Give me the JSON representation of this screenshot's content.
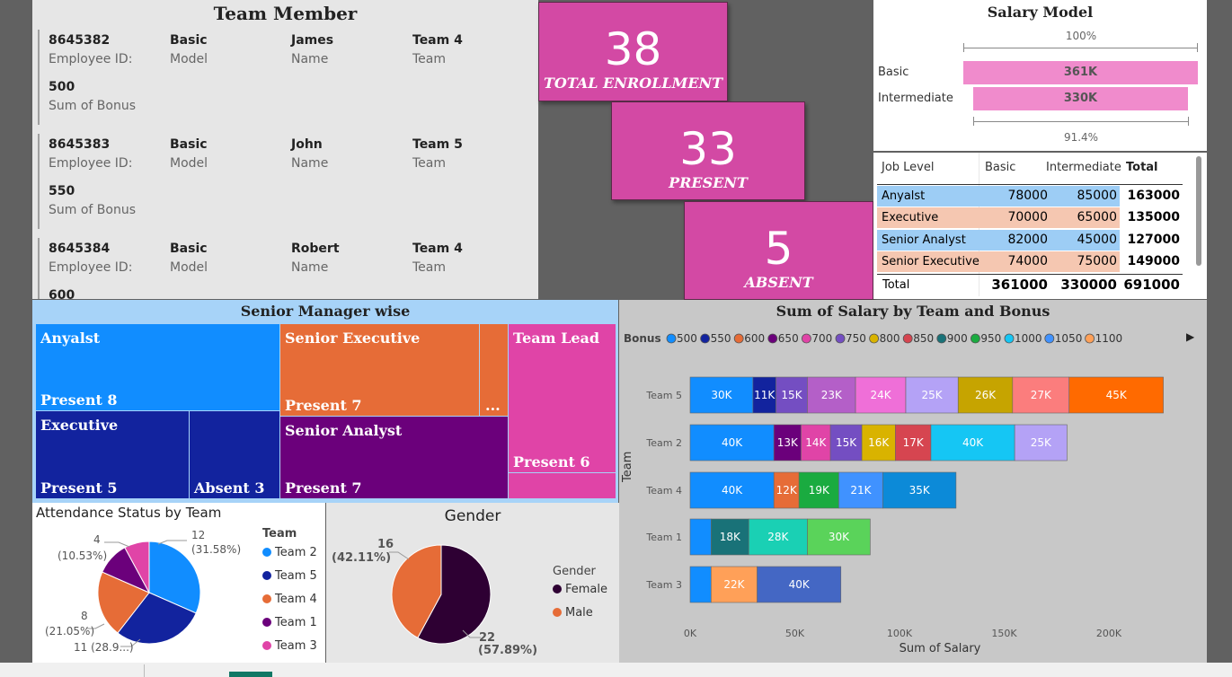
{
  "team_member": {
    "title": "Team Member",
    "labels": {
      "id": "Employee ID:",
      "model": "Model",
      "name": "Name",
      "team": "Team",
      "bonus": "Sum of Bonus"
    },
    "cards": [
      {
        "id": "8645382",
        "model": "Basic",
        "name": "James",
        "team": "Team 4",
        "bonus": "500"
      },
      {
        "id": "8645383",
        "model": "Basic",
        "name": "John",
        "team": "Team 5",
        "bonus": "550"
      },
      {
        "id": "8645384",
        "model": "Basic",
        "name": "Robert",
        "team": "Team 4",
        "bonus": "600"
      }
    ]
  },
  "kpis": [
    {
      "value": "38",
      "label": "TOTAL ENROLLMENT"
    },
    {
      "value": "33",
      "label": "PRESENT"
    },
    {
      "value": "5",
      "label": "ABSENT"
    }
  ],
  "salary_model": {
    "title": "Salary Model",
    "top_pct": "100%",
    "bottom_pct": "91.4%",
    "bars": [
      {
        "label": "Basic",
        "value_label": "361K",
        "value": 361000
      },
      {
        "label": "Intermediate",
        "value_label": "330K",
        "value": 330000
      }
    ]
  },
  "salary_table": {
    "headers": [
      "Job Level",
      "Basic",
      "Intermediate",
      "Total"
    ],
    "rows": [
      {
        "level": "Anyalst",
        "basic": "78000",
        "inter": "85000",
        "total": "163000",
        "color": "#9dcdf5"
      },
      {
        "level": "Executive",
        "basic": "70000",
        "inter": "65000",
        "total": "135000",
        "color": "#f5c7b1"
      },
      {
        "level": "Senior Analyst",
        "basic": "82000",
        "inter": "45000",
        "total": "127000",
        "color": "#9dcdf5"
      },
      {
        "level": "Senior Executive",
        "basic": "74000",
        "inter": "75000",
        "total": "149000",
        "color": "#f5c7b1"
      }
    ],
    "total_row": {
      "level": "Total",
      "basic": "361000",
      "inter": "330000",
      "total": "691000"
    }
  },
  "treemap": {
    "title": "Senior Manager wise",
    "cells": {
      "anyalst": {
        "title": "Anyalst",
        "sub": "Present 8"
      },
      "senior_exec": {
        "title": "Senior Executive",
        "sub": "Present 7"
      },
      "ellipsis": "...",
      "team_lead": {
        "title": "Team Lead",
        "sub": "Present 6"
      },
      "executive": {
        "title": "Executive",
        "sub": "Present 5"
      },
      "exec_absent": {
        "sub": "Absent 3"
      },
      "senior_analyst": {
        "title": "Senior Analyst",
        "sub": "Present 7"
      }
    }
  },
  "attendance": {
    "title": "Attendance Status by Team",
    "legend_title": "Team",
    "labels": {
      "l12a": "12",
      "l12b": "(31.58%)",
      "l4a": "4",
      "l4b": "(10.53%)",
      "l8a": "8",
      "l8b": "(21.05%)",
      "l11": "11 (28.9...)"
    }
  },
  "gender": {
    "title": "Gender",
    "legend_title": "Gender",
    "labels": {
      "l16a": "16",
      "l16b": "(42.11%)",
      "l22a": "22",
      "l22b": "(57.89%)"
    }
  },
  "bar_chart": {
    "title": "Sum of Salary by Team and Bonus",
    "legend_title": "Bonus",
    "x_title": "Sum of Salary",
    "y_title": "Team"
  },
  "chart_data": [
    {
      "type": "pie",
      "title": "Attendance Status by Team",
      "legend_title": "Team",
      "slices": [
        {
          "label": "Team 2",
          "value": 12,
          "color": "#118dff"
        },
        {
          "label": "Team 5",
          "value": 11,
          "color": "#12239e"
        },
        {
          "label": "Team 4",
          "value": 8,
          "color": "#e66c37"
        },
        {
          "label": "Team 1",
          "value": 4,
          "color": "#6b007b"
        },
        {
          "label": "Team 3",
          "value": 3,
          "color": "#e044a7"
        }
      ]
    },
    {
      "type": "pie",
      "title": "Gender",
      "legend_title": "Gender",
      "slices": [
        {
          "label": "Female",
          "value": 22,
          "color": "#2e0033"
        },
        {
          "label": "Male",
          "value": 16,
          "color": "#e66c37"
        }
      ]
    },
    {
      "type": "bar",
      "orientation": "horizontal",
      "stacked": true,
      "title": "Sum of Salary by Team and Bonus",
      "xlabel": "Sum of Salary",
      "ylabel": "Team",
      "xlim": [
        0,
        250000
      ],
      "x_ticks": [
        "0K",
        "50K",
        "100K",
        "150K",
        "200K"
      ],
      "legend": {
        "title": "Bonus",
        "items": [
          {
            "label": "500",
            "color": "#118dff"
          },
          {
            "label": "550",
            "color": "#12239e"
          },
          {
            "label": "600",
            "color": "#e66c37"
          },
          {
            "label": "650",
            "color": "#6b007b"
          },
          {
            "label": "700",
            "color": "#e044a7"
          },
          {
            "label": "750",
            "color": "#744ec2"
          },
          {
            "label": "800",
            "color": "#d9b300"
          },
          {
            "label": "850",
            "color": "#d64550"
          },
          {
            "label": "900",
            "color": "#197278"
          },
          {
            "label": "950",
            "color": "#1aab40"
          },
          {
            "label": "1000",
            "color": "#15c6f4"
          },
          {
            "label": "1050",
            "color": "#4092ff"
          },
          {
            "label": "1100",
            "color": "#ffa058"
          }
        ]
      },
      "categories": [
        "Team 5",
        "Team 2",
        "Team 4",
        "Team 1",
        "Team 3"
      ],
      "bars": [
        {
          "team": "Team 5",
          "segments": [
            {
              "value": 30000,
              "label": "30K",
              "color": "#118dff"
            },
            {
              "value": 11000,
              "label": "11K",
              "color": "#12239e"
            },
            {
              "value": 15000,
              "label": "15K",
              "color": "#744ec2"
            },
            {
              "value": 23000,
              "label": "23K",
              "color": "#b45fc8"
            },
            {
              "value": 24000,
              "label": "24K",
              "color": "#ef6fd8"
            },
            {
              "value": 25000,
              "label": "25K",
              "color": "#b4a2f6"
            },
            {
              "value": 26000,
              "label": "26K",
              "color": "#c6a400"
            },
            {
              "value": 27000,
              "label": "27K",
              "color": "#fb7d7d"
            },
            {
              "value": 45000,
              "label": "45K",
              "color": "#ff6a00"
            }
          ]
        },
        {
          "team": "Team 2",
          "segments": [
            {
              "value": 40000,
              "label": "40K",
              "color": "#118dff"
            },
            {
              "value": 13000,
              "label": "13K",
              "color": "#6b007b"
            },
            {
              "value": 14000,
              "label": "14K",
              "color": "#e044a7"
            },
            {
              "value": 15000,
              "label": "15K",
              "color": "#744ec2"
            },
            {
              "value": 16000,
              "label": "16K",
              "color": "#d9b300"
            },
            {
              "value": 17000,
              "label": "17K",
              "color": "#d64550"
            },
            {
              "value": 40000,
              "label": "40K",
              "color": "#15c6f4"
            },
            {
              "value": 25000,
              "label": "25K",
              "color": "#b4a2f6"
            }
          ]
        },
        {
          "team": "Team 4",
          "segments": [
            {
              "value": 40000,
              "label": "40K",
              "color": "#118dff"
            },
            {
              "value": 12000,
              "label": "12K",
              "color": "#e66c37"
            },
            {
              "value": 19000,
              "label": "19K",
              "color": "#1aab40"
            },
            {
              "value": 21000,
              "label": "21K",
              "color": "#4092ff"
            },
            {
              "value": 35000,
              "label": "35K",
              "color": "#0c8ad8"
            }
          ]
        },
        {
          "team": "Team 1",
          "segments": [
            {
              "value": 10000,
              "label": "",
              "color": "#118dff"
            },
            {
              "value": 18000,
              "label": "18K",
              "color": "#197278"
            },
            {
              "value": 28000,
              "label": "28K",
              "color": "#1ad0b4"
            },
            {
              "value": 30000,
              "label": "30K",
              "color": "#5ad35a"
            }
          ]
        },
        {
          "team": "Team 3",
          "segments": [
            {
              "value": 10000,
              "label": "",
              "color": "#118dff"
            },
            {
              "value": 22000,
              "label": "22K",
              "color": "#ffa058"
            },
            {
              "value": 40000,
              "label": "40K",
              "color": "#4467c4"
            }
          ]
        }
      ]
    }
  ]
}
